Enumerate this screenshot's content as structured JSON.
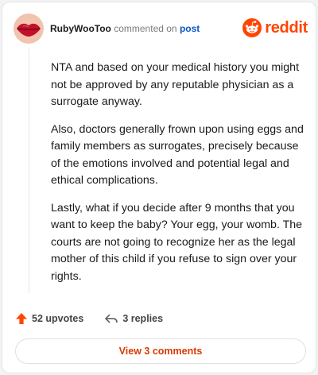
{
  "comment": {
    "author": "RubyWooToo",
    "action_text": "commented on",
    "post_link": "post",
    "brand": "reddit",
    "paragraphs": [
      "NTA and based on your medical history you might not be approved by any reputable physician as a surrogate anyway.",
      "Also, doctors generally frown upon using eggs and family members as surrogates, precisely because of the emotions involved and potential legal and ethical complications.",
      "Lastly, what if you decide after 9 months that you want to keep the baby? Your egg, your womb. The courts are not going to recognize her as the legal mother of this child if you refuse to sign over your rights."
    ],
    "upvotes_label": "52 upvotes",
    "replies_label": "3 replies",
    "view_comments_label": "View 3 comments"
  },
  "colors": {
    "brand": "#ff4500",
    "upvote": "#ff4500",
    "view_button_text": "#d93a00",
    "link": "#0b57c9"
  },
  "icons": {
    "avatar": "lips-avatar",
    "brand": "reddit-snoo-icon",
    "upvote": "upvote-arrow-icon",
    "reply": "reply-arrow-icon"
  }
}
